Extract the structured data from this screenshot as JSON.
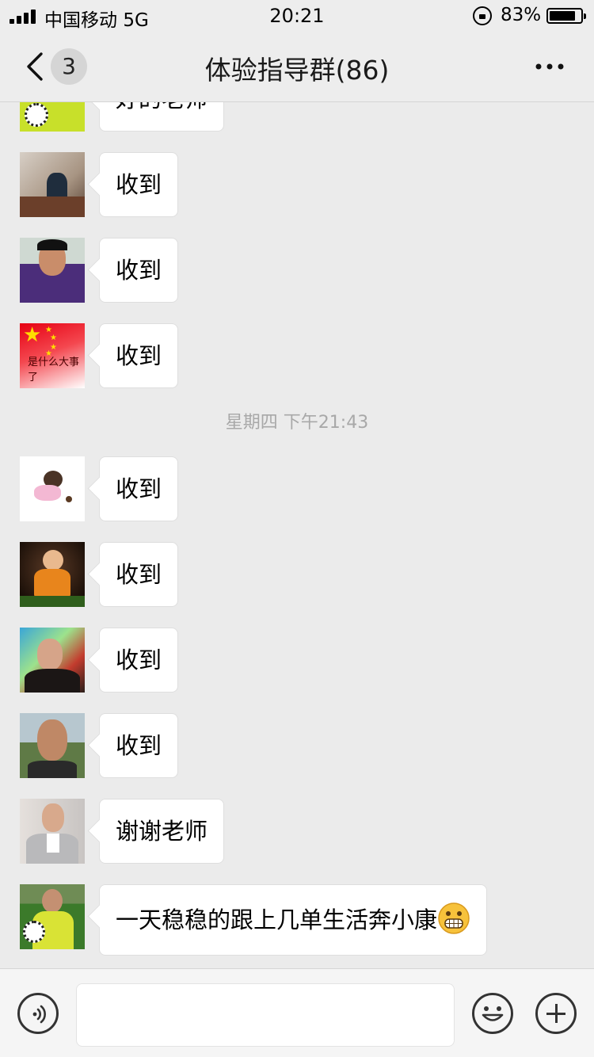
{
  "status_bar": {
    "carrier": "中国移动",
    "network": "5G",
    "time": "20:21",
    "battery_percent": "83%",
    "battery_level": 0.83
  },
  "nav": {
    "unread_count": "3",
    "title": "体验指导群(86)"
  },
  "chat": {
    "timestamp": "星期四 下午21:43",
    "messages": [
      {
        "text": "好的老师",
        "avatar": "player-with-ball"
      },
      {
        "text": "收到",
        "avatar": "man-at-table"
      },
      {
        "text": "收到",
        "avatar": "man-purple-jacket"
      },
      {
        "text": "收到",
        "avatar": "red-flag",
        "avatar_text": "是什么大事了"
      },
      {
        "text": "收到",
        "avatar": "cartoon-girl"
      },
      {
        "text": "收到",
        "avatar": "monk-figurine"
      },
      {
        "text": "收到",
        "avatar": "man-neon-lights"
      },
      {
        "text": "收到",
        "avatar": "bald-man"
      },
      {
        "text": "谢谢老师",
        "avatar": "man-in-suit"
      },
      {
        "text": "一天稳稳的跟上几单生活奔小康",
        "avatar": "player-with-ball",
        "emoji": "grinning-face"
      }
    ]
  },
  "input_bar": {
    "message_value": ""
  },
  "colors": {
    "background": "#ebebeb",
    "bubble": "#ffffff",
    "timestamp": "#a8a8a8"
  }
}
